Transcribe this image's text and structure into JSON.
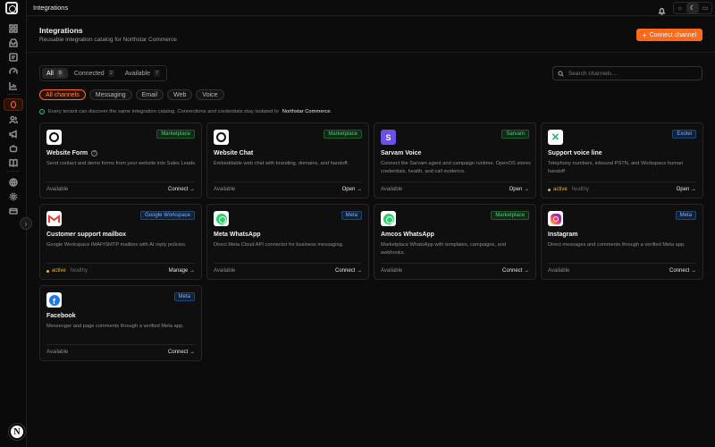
{
  "topbar": {
    "title": "Integrations",
    "theme_options": [
      "sun-icon",
      "moon-icon",
      "monitor-icon"
    ]
  },
  "sidebar": {
    "user_initial": "N",
    "icons": [
      "dashboard-icon",
      "inbox-icon",
      "list-icon",
      "gauge-icon",
      "chart-icon",
      "integrations-icon",
      "users-icon",
      "megaphone-icon",
      "bot-icon",
      "book-icon",
      "globe-icon",
      "settings-icon",
      "billing-icon"
    ]
  },
  "header": {
    "title": "Integrations",
    "subtitle": "Reusable integration catalog for Northstar Commerce",
    "connect_label": "Connect channel"
  },
  "status_tabs": [
    {
      "label": "All",
      "count": "9"
    },
    {
      "label": "Connected",
      "count": "2"
    },
    {
      "label": "Available",
      "count": "7"
    }
  ],
  "search": {
    "placeholder": "Search channels..."
  },
  "filters": [
    "All channels",
    "Messaging",
    "Email",
    "Web",
    "Voice"
  ],
  "notice": {
    "text": "Every tenant can discover the same integration catalog. Connections and credentials stay isolated to",
    "org": "Northstar Commerce",
    "end": "."
  },
  "cards": [
    {
      "name": "Website Form",
      "badge": "Marketplace",
      "desc": "Send contact and demo forms from your website into Sales Leads.",
      "status": "Available",
      "health": "",
      "action": "Connect →"
    },
    {
      "name": "Website Chat",
      "badge": "Marketplace",
      "desc": "Embeddable web chat with branding, domains, and handoff.",
      "status": "Available",
      "health": "",
      "action": "Open →"
    },
    {
      "name": "Sarvam Voice",
      "badge": "Sarvam",
      "desc": "Connect the Sarvam agent and campaign runtime. OpenOS stores credentials, health, and call evidence.",
      "status": "Available",
      "health": "",
      "action": "Open →"
    },
    {
      "name": "Support voice line",
      "badge": "Exotel",
      "desc": "Telephony numbers, inbound PSTN, and Workspace human handoff",
      "status": "active",
      "health": "healthy",
      "action": "Open →"
    },
    {
      "name": "Customer support mailbox",
      "badge": "Google Workspace",
      "desc": "Google Workspace IMAP/SMTP mailbox with AI reply policies.",
      "status": "active",
      "health": "healthy",
      "action": "Manage →"
    },
    {
      "name": "Meta WhatsApp",
      "badge": "Meta",
      "desc": "Direct Meta Cloud API connector for business messaging.",
      "status": "Available",
      "health": "",
      "action": "Connect →"
    },
    {
      "name": "Amcos WhatsApp",
      "badge": "Marketplace",
      "desc": "Marketplace WhatsApp with templates, campaigns, and webhooks.",
      "status": "Available",
      "health": "",
      "action": "Connect →"
    },
    {
      "name": "Instagram",
      "badge": "Meta",
      "desc": "Direct messages and comments through a verified Meta app.",
      "status": "Available",
      "health": "",
      "action": "Connect →"
    },
    {
      "name": "Facebook",
      "badge": "Meta",
      "desc": "Messenger and page comments through a verified Meta app.",
      "status": "Available",
      "health": "",
      "action": "Connect →"
    }
  ],
  "icon_glyphs": {
    "sarvam": "S",
    "telephony": "✕",
    "facebook": "f"
  }
}
